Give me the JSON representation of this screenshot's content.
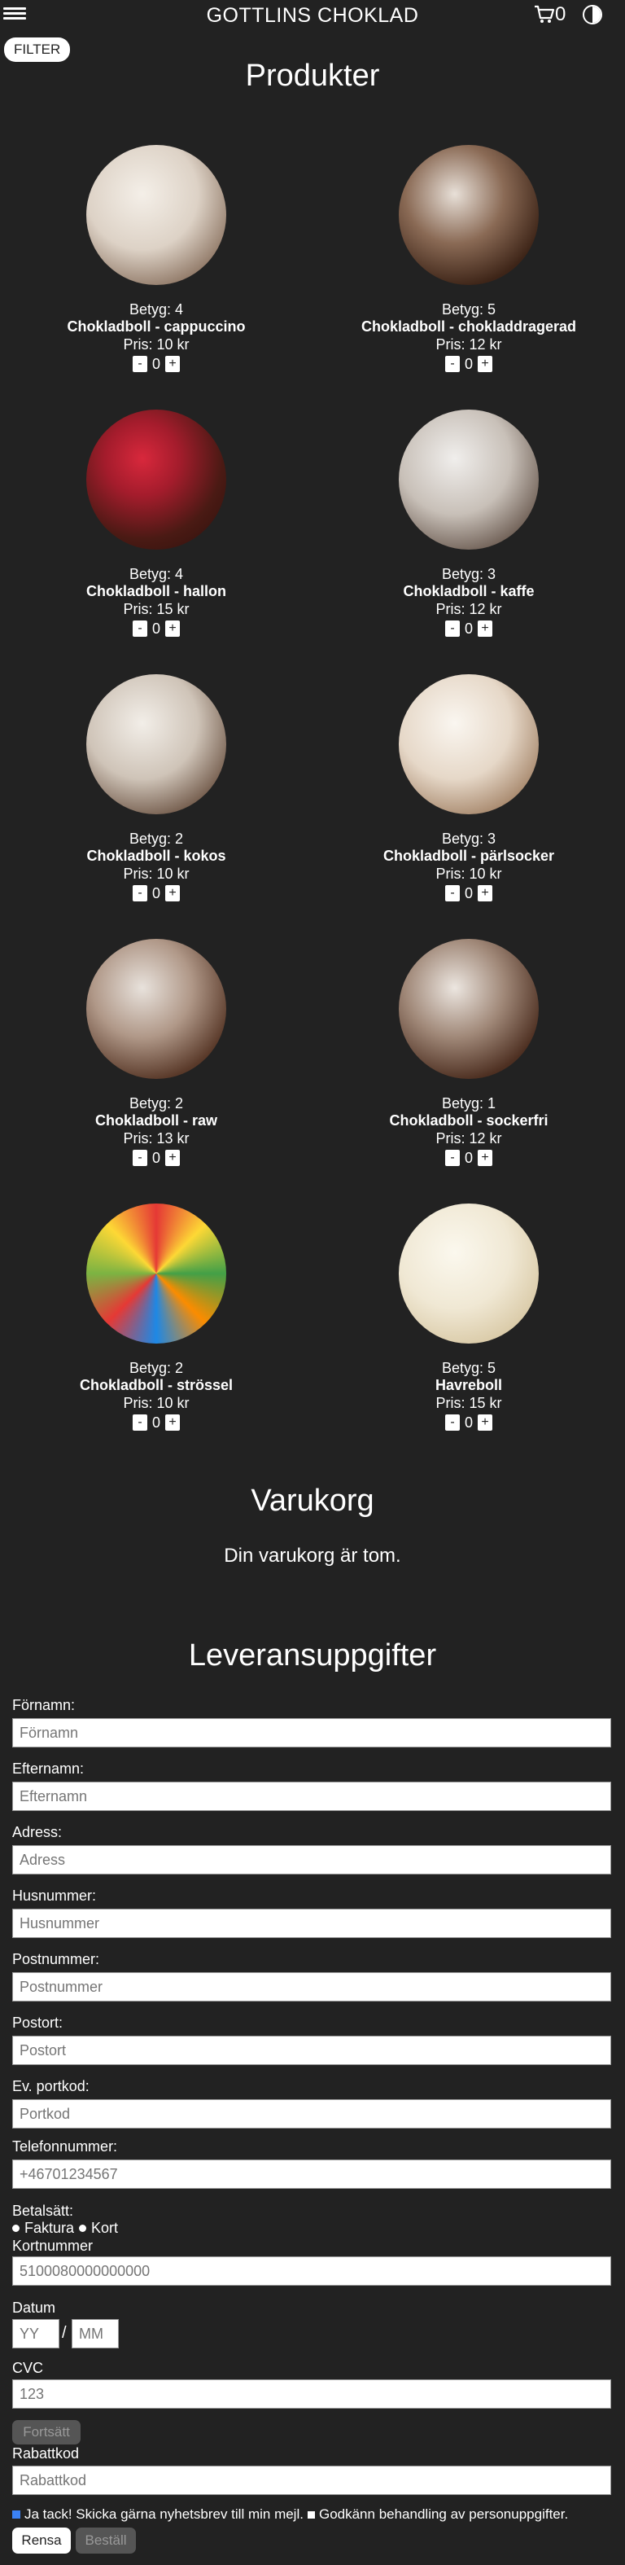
{
  "header": {
    "title": "GOTTLINS CHOKLAD",
    "cart_count": "0"
  },
  "filter": {
    "label": "FILTER"
  },
  "products_section": {
    "title": "Produkter"
  },
  "products": [
    {
      "rating": "Betyg: 4",
      "name": "Chokladboll - cappuccino",
      "price": "Pris: 10 kr",
      "qty": "0",
      "minus": "-",
      "plus": "+"
    },
    {
      "rating": "Betyg: 5",
      "name": "Chokladboll - chokladdragerad",
      "price": "Pris: 12 kr",
      "qty": "0",
      "minus": "-",
      "plus": "+"
    },
    {
      "rating": "Betyg: 4",
      "name": "Chokladboll - hallon",
      "price": "Pris: 15 kr",
      "qty": "0",
      "minus": "-",
      "plus": "+"
    },
    {
      "rating": "Betyg: 3",
      "name": "Chokladboll - kaffe",
      "price": "Pris: 12 kr",
      "qty": "0",
      "minus": "-",
      "plus": "+"
    },
    {
      "rating": "Betyg: 2",
      "name": "Chokladboll - kokos",
      "price": "Pris: 10 kr",
      "qty": "0",
      "minus": "-",
      "plus": "+"
    },
    {
      "rating": "Betyg: 3",
      "name": "Chokladboll - pärlsocker",
      "price": "Pris: 10 kr",
      "qty": "0",
      "minus": "-",
      "plus": "+"
    },
    {
      "rating": "Betyg: 2",
      "name": "Chokladboll - raw",
      "price": "Pris: 13 kr",
      "qty": "0",
      "minus": "-",
      "plus": "+"
    },
    {
      "rating": "Betyg: 1",
      "name": "Chokladboll - sockerfri",
      "price": "Pris: 12 kr",
      "qty": "0",
      "minus": "-",
      "plus": "+"
    },
    {
      "rating": "Betyg: 2",
      "name": "Chokladboll - strössel",
      "price": "Pris: 10 kr",
      "qty": "0",
      "minus": "-",
      "plus": "+"
    },
    {
      "rating": "Betyg: 5",
      "name": "Havreboll",
      "price": "Pris: 15 kr",
      "qty": "0",
      "minus": "-",
      "plus": "+"
    }
  ],
  "cart": {
    "title": "Varukorg",
    "empty_text": "Din varukorg är tom."
  },
  "delivery": {
    "title": "Leveransuppgifter",
    "fields": [
      {
        "label": "Förnamn:",
        "placeholder": "Förnamn"
      },
      {
        "label": "Efternamn:",
        "placeholder": "Efternamn"
      },
      {
        "label": "Adress:",
        "placeholder": "Adress"
      },
      {
        "label": "Husnummer:",
        "placeholder": "Husnummer"
      },
      {
        "label": "Postnummer:",
        "placeholder": "Postnummer"
      },
      {
        "label": "Postort:",
        "placeholder": "Postort"
      },
      {
        "label": "Ev. portkod:",
        "placeholder": "Portkod"
      },
      {
        "label": "Telefonnummer:",
        "placeholder": "+46701234567"
      }
    ],
    "payment_label": "Betalsätt:",
    "payment_option_1": "Faktura",
    "payment_option_2": "Kort",
    "card_label": "Kortnummer",
    "card_placeholder": "5100080000000000",
    "date_label": "Datum",
    "year_placeholder": "YY",
    "date_separator": "/",
    "month_placeholder": "MM",
    "cvc_label": "CVC",
    "cvc_placeholder": "123",
    "continue_label": "Fortsätt",
    "discount_label": "Rabattkod",
    "discount_placeholder": "Rabattkod",
    "newsletter_label": "Ja tack! Skicka gärna nyhetsbrev till min mejl.",
    "terms_label": "Godkänn behandling av personuppgifter.",
    "reset_label": "Rensa",
    "order_label": "Beställ"
  }
}
